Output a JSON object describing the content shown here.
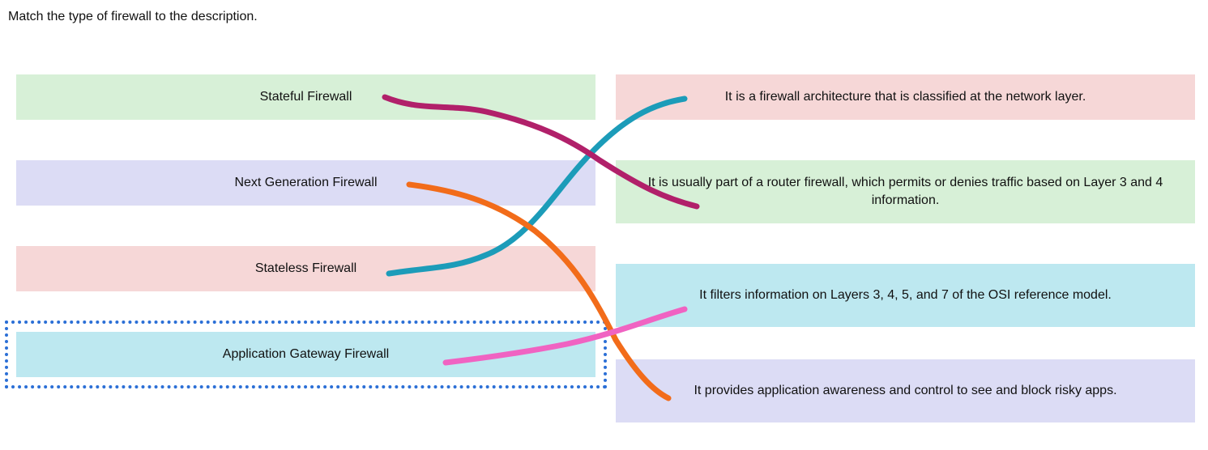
{
  "prompt": "Match the type of firewall to the description.",
  "left": {
    "stateful": {
      "label": "Stateful Firewall"
    },
    "nextgen": {
      "label": "Next Generation Firewall"
    },
    "stateless": {
      "label": "Stateless Firewall"
    },
    "appgw": {
      "label": "Application Gateway Firewall"
    }
  },
  "right": {
    "arch_net_layer": {
      "label": "It is a firewall architecture that is classified at the network layer."
    },
    "router_l3l4": {
      "label": "It is usually part of a router firewall, which permits or denies traffic based on Layer 3 and 4 information."
    },
    "layers_3457": {
      "label": "It filters information on Layers 3, 4, 5, and 7 of the OSI reference model."
    },
    "app_awareness": {
      "label": "It provides application awareness and control to see and block risky apps."
    }
  },
  "connections": [
    {
      "from": "stateful",
      "to": "router_l3l4",
      "color": "#b1206a"
    },
    {
      "from": "nextgen",
      "to": "app_awareness",
      "color": "#f26c1a"
    },
    {
      "from": "stateless",
      "to": "arch_net_layer",
      "color": "#1c9cb9"
    },
    {
      "from": "appgw",
      "to": "layers_3457",
      "color": "#f063c2"
    }
  ],
  "colors": {
    "green": "#d7f0d7",
    "purple": "#dcdcf5",
    "pink": "#f6d7d7",
    "cyan": "#bde8f0",
    "dotted_border": "#2b6fd6"
  },
  "selected_left": "appgw"
}
